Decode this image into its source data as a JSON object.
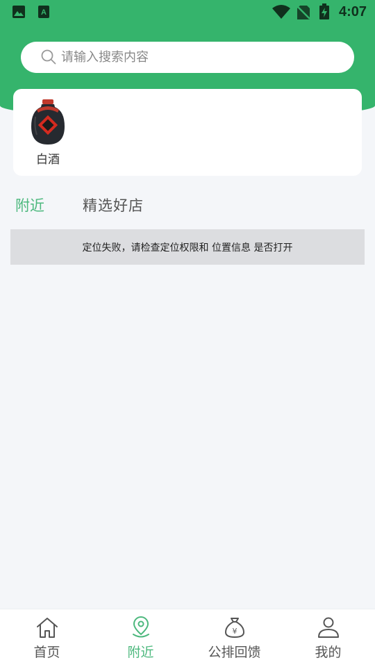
{
  "status_bar": {
    "time": "4:07",
    "icons": [
      "image-icon",
      "a-icon",
      "wifi-icon",
      "no-sim-icon",
      "battery-charging-icon"
    ]
  },
  "search": {
    "placeholder": "请输入搜索内容",
    "icon": "search-icon"
  },
  "categories": [
    {
      "label": "白酒",
      "icon": "baijiu-bottle-icon"
    }
  ],
  "tabs": [
    {
      "label": "附近",
      "active": true
    },
    {
      "label": "精选好店",
      "active": false
    }
  ],
  "notice": {
    "text": "定位失败，请检查定位权限和 位置信息 是否打开"
  },
  "bottom_nav": [
    {
      "label": "首页",
      "icon": "home-icon",
      "active": false
    },
    {
      "label": "附近",
      "icon": "location-pin-icon",
      "active": true
    },
    {
      "label": "公排回馈",
      "icon": "money-bag-icon",
      "active": false
    },
    {
      "label": "我的",
      "icon": "user-icon",
      "active": false
    }
  ],
  "colors": {
    "primary": "#35b46c",
    "active_text": "#4cb87d",
    "page_bg": "#f4f6f9",
    "notice_bg": "#dcdde0"
  }
}
